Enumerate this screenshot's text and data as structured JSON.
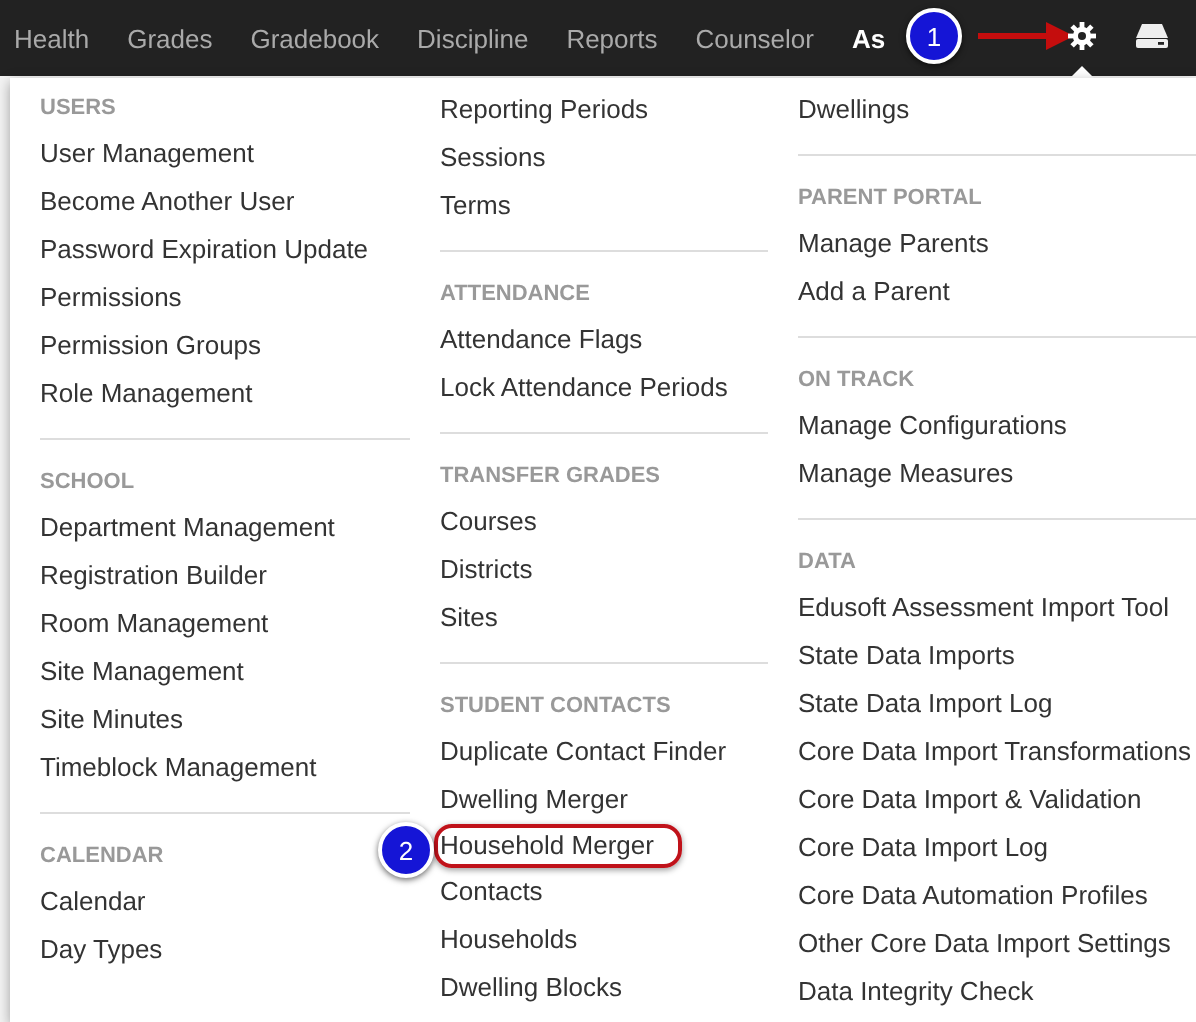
{
  "nav": {
    "items": [
      {
        "label": "Health",
        "selected": false
      },
      {
        "label": "Grades",
        "selected": false
      },
      {
        "label": "Gradebook",
        "selected": false
      },
      {
        "label": "Discipline",
        "selected": false
      },
      {
        "label": "Reports",
        "selected": false
      },
      {
        "label": "Counselor",
        "selected": false
      },
      {
        "label": "As",
        "selected": true
      }
    ]
  },
  "callouts": [
    {
      "label": "1"
    },
    {
      "label": "2"
    }
  ],
  "menu": {
    "columns": [
      {
        "sections": [
          {
            "header": "USERS",
            "items": [
              {
                "label": "User Management",
                "highlighted": false
              },
              {
                "label": "Become Another User",
                "highlighted": false
              },
              {
                "label": "Password Expiration Update",
                "highlighted": false
              },
              {
                "label": "Permissions",
                "highlighted": false
              },
              {
                "label": "Permission Groups",
                "highlighted": false
              },
              {
                "label": "Role Management",
                "highlighted": false
              }
            ]
          },
          {
            "header": "SCHOOL",
            "items": [
              {
                "label": "Department Management",
                "highlighted": false
              },
              {
                "label": "Registration Builder",
                "highlighted": false
              },
              {
                "label": "Room Management",
                "highlighted": false
              },
              {
                "label": "Site Management",
                "highlighted": false
              },
              {
                "label": "Site Minutes",
                "highlighted": false
              },
              {
                "label": "Timeblock Management",
                "highlighted": false
              }
            ]
          },
          {
            "header": "CALENDAR",
            "items": [
              {
                "label": "Calendar",
                "highlighted": false
              },
              {
                "label": "Day Types",
                "highlighted": false
              }
            ]
          }
        ]
      },
      {
        "sections": [
          {
            "items": [
              {
                "label": "Reporting Periods",
                "highlighted": false
              },
              {
                "label": "Sessions",
                "highlighted": false
              },
              {
                "label": "Terms",
                "highlighted": false
              }
            ]
          },
          {
            "header": "ATTENDANCE",
            "items": [
              {
                "label": "Attendance Flags",
                "highlighted": false
              },
              {
                "label": "Lock Attendance Periods",
                "highlighted": false
              }
            ]
          },
          {
            "header": "TRANSFER GRADES",
            "items": [
              {
                "label": "Courses",
                "highlighted": false
              },
              {
                "label": "Districts",
                "highlighted": false
              },
              {
                "label": "Sites",
                "highlighted": false
              }
            ]
          },
          {
            "header": "STUDENT CONTACTS",
            "items": [
              {
                "label": "Duplicate Contact Finder",
                "highlighted": false
              },
              {
                "label": "Dwelling Merger",
                "highlighted": false
              },
              {
                "label": "Household Merger",
                "highlighted": true
              },
              {
                "label": "Contacts",
                "highlighted": false
              },
              {
                "label": "Households",
                "highlighted": false
              },
              {
                "label": "Dwelling Blocks",
                "highlighted": false
              }
            ]
          }
        ]
      },
      {
        "sections": [
          {
            "items": [
              {
                "label": "Dwellings",
                "highlighted": false
              }
            ]
          },
          {
            "header": "PARENT PORTAL",
            "items": [
              {
                "label": "Manage Parents",
                "highlighted": false
              },
              {
                "label": "Add a Parent",
                "highlighted": false
              }
            ]
          },
          {
            "header": "ON TRACK",
            "items": [
              {
                "label": "Manage Configurations",
                "highlighted": false
              },
              {
                "label": "Manage Measures",
                "highlighted": false
              }
            ]
          },
          {
            "header": "DATA",
            "items": [
              {
                "label": "Edusoft Assessment Import Tool",
                "highlighted": false
              },
              {
                "label": "State Data Imports",
                "highlighted": false
              },
              {
                "label": "State Data Import Log",
                "highlighted": false
              },
              {
                "label": "Core Data Import Transformations",
                "highlighted": false
              },
              {
                "label": "Core Data Import & Validation",
                "highlighted": false
              },
              {
                "label": "Core Data Import Log",
                "highlighted": false
              },
              {
                "label": "Core Data Automation Profiles",
                "highlighted": false
              },
              {
                "label": "Other Core Data Import Settings",
                "highlighted": false
              },
              {
                "label": "Data Integrity Check",
                "highlighted": false
              }
            ]
          }
        ]
      }
    ]
  }
}
